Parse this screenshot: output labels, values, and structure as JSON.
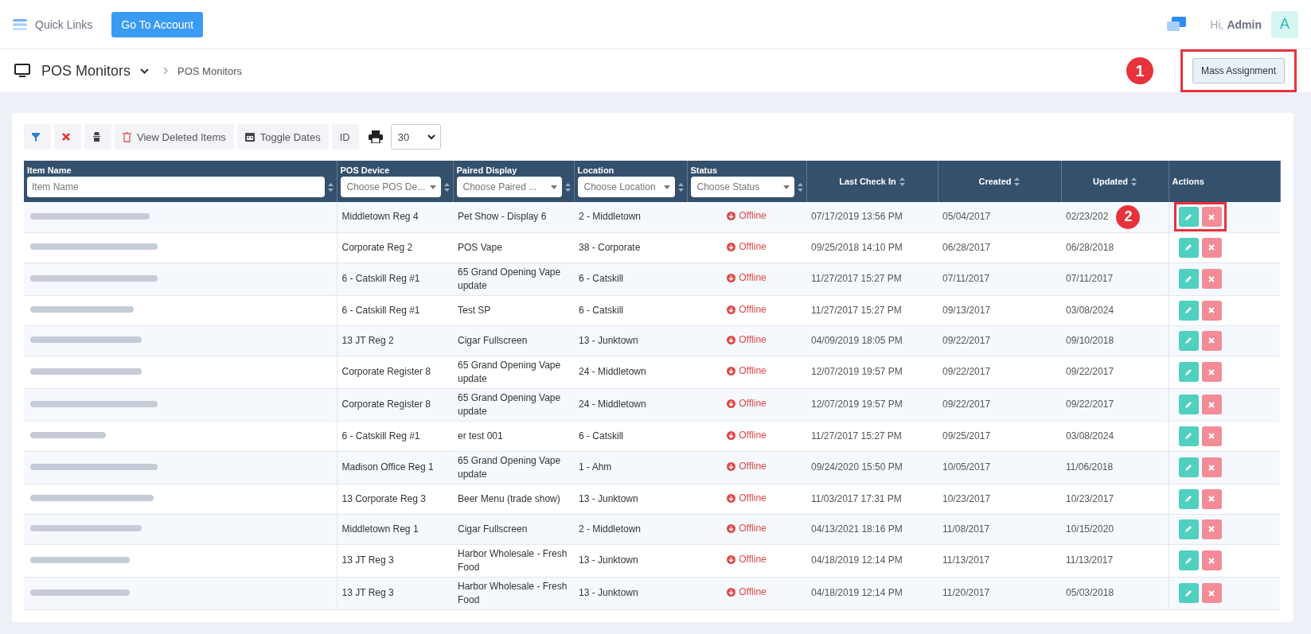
{
  "topbar": {
    "menu_label": "Quick Links",
    "account_button": "Go To Account",
    "greeting": "Hi,",
    "user": "Admin",
    "avatar": "A"
  },
  "page_header": {
    "title": "POS Monitors",
    "breadcrumb": "POS Monitors",
    "callout": "1",
    "mass_button": "Mass Assignment"
  },
  "toolbar": {
    "view_deleted": "View Deleted Items",
    "toggle_dates": "Toggle Dates",
    "id_button": "ID",
    "page_size": "30"
  },
  "table": {
    "columns": [
      {
        "label": "Item Name",
        "kind": "text",
        "placeholder": "Item Name",
        "sortable": true
      },
      {
        "label": "POS Device",
        "kind": "select",
        "placeholder": "Choose POS De...",
        "sortable": true
      },
      {
        "label": "Paired Display",
        "kind": "select",
        "placeholder": "Choose Paired ...",
        "sortable": true
      },
      {
        "label": "Location",
        "kind": "select",
        "placeholder": "Choose Location",
        "sortable": true
      },
      {
        "label": "Status",
        "kind": "select",
        "placeholder": "Choose Status",
        "sortable": true
      },
      {
        "label": "Last Check In",
        "kind": "plain",
        "sortable": true
      },
      {
        "label": "Created",
        "kind": "plain",
        "sortable": true
      },
      {
        "label": "Updated",
        "kind": "plain",
        "sortable": true
      },
      {
        "label": "Actions",
        "kind": "plain",
        "sortable": false
      }
    ],
    "rows": [
      {
        "pos_device": "Middletown Reg 4",
        "paired_display": "Pet Show - Display 6",
        "location": "2 - Middletown",
        "status": "Offline",
        "last_check_in": "07/17/2019 13:56 PM",
        "created": "05/04/2017",
        "updated": "02/23/202",
        "callout": "2",
        "highlighted": true
      },
      {
        "pos_device": "Corporate Reg 2",
        "paired_display": "POS Vape",
        "location": "38 - Corporate",
        "status": "Offline",
        "last_check_in": "09/25/2018 14:10 PM",
        "created": "06/28/2017",
        "updated": "06/28/2018",
        "highlighted": false
      },
      {
        "pos_device": "6 - Catskill Reg #1",
        "paired_display": "65 Grand Opening Vape update",
        "location": "6 - Catskill",
        "status": "Offline",
        "last_check_in": "11/27/2017 15:27 PM",
        "created": "07/11/2017",
        "updated": "07/11/2017",
        "highlighted": false
      },
      {
        "pos_device": "6 - Catskill Reg #1",
        "paired_display": "Test SP",
        "location": "6 - Catskill",
        "status": "Offline",
        "last_check_in": "11/27/2017 15:27 PM",
        "created": "09/13/2017",
        "updated": "03/08/2024",
        "highlighted": false
      },
      {
        "pos_device": "13 JT Reg 2",
        "paired_display": "Cigar Fullscreen",
        "location": "13 - Junktown",
        "status": "Offline",
        "last_check_in": "04/09/2019 18:05 PM",
        "created": "09/22/2017",
        "updated": "09/10/2018",
        "highlighted": false
      },
      {
        "pos_device": "Corporate Register 8",
        "paired_display": "65 Grand Opening Vape update",
        "location": "24 - Middletown",
        "status": "Offline",
        "last_check_in": "12/07/2019 19:57 PM",
        "created": "09/22/2017",
        "updated": "09/22/2017",
        "highlighted": false
      },
      {
        "pos_device": "Corporate Register 8",
        "paired_display": "65 Grand Opening Vape update",
        "location": "24 - Middletown",
        "status": "Offline",
        "last_check_in": "12/07/2019 19:57 PM",
        "created": "09/22/2017",
        "updated": "09/22/2017",
        "highlighted": false
      },
      {
        "pos_device": "6 - Catskill Reg #1",
        "paired_display": "er test 001",
        "location": "6 - Catskill",
        "status": "Offline",
        "last_check_in": "11/27/2017 15:27 PM",
        "created": "09/25/2017",
        "updated": "03/08/2024",
        "highlighted": false
      },
      {
        "pos_device": "Madison Office Reg 1",
        "paired_display": "65 Grand Opening Vape update",
        "location": "1 - Ahm",
        "status": "Offline",
        "last_check_in": "09/24/2020 15:50 PM",
        "created": "10/05/2017",
        "updated": "11/06/2018",
        "highlighted": false
      },
      {
        "pos_device": "13 Corporate Reg 3",
        "paired_display": "Beer Menu (trade show)",
        "location": "13 - Junktown",
        "status": "Offline",
        "last_check_in": "11/03/2017 17:31 PM",
        "created": "10/23/2017",
        "updated": "10/23/2017",
        "highlighted": false
      },
      {
        "pos_device": "Middletown Reg 1",
        "paired_display": "Cigar Fullscreen",
        "location": "2 - Middletown",
        "status": "Offline",
        "last_check_in": "04/13/2021 18:16 PM",
        "created": "11/08/2017",
        "updated": "10/15/2020",
        "highlighted": false
      },
      {
        "pos_device": "13 JT Reg 3",
        "paired_display": "Harbor Wholesale - Fresh Food",
        "location": "13 - Junktown",
        "status": "Offline",
        "last_check_in": "04/18/2019 12:14 PM",
        "created": "11/13/2017",
        "updated": "11/13/2017",
        "highlighted": false
      },
      {
        "pos_device": "13 JT Reg 3",
        "paired_display": "Harbor Wholesale - Fresh Food",
        "location": "13 - Junktown",
        "status": "Offline",
        "last_check_in": "04/18/2019 12:14 PM",
        "created": "11/20/2017",
        "updated": "05/03/2018",
        "highlighted": false
      }
    ]
  }
}
